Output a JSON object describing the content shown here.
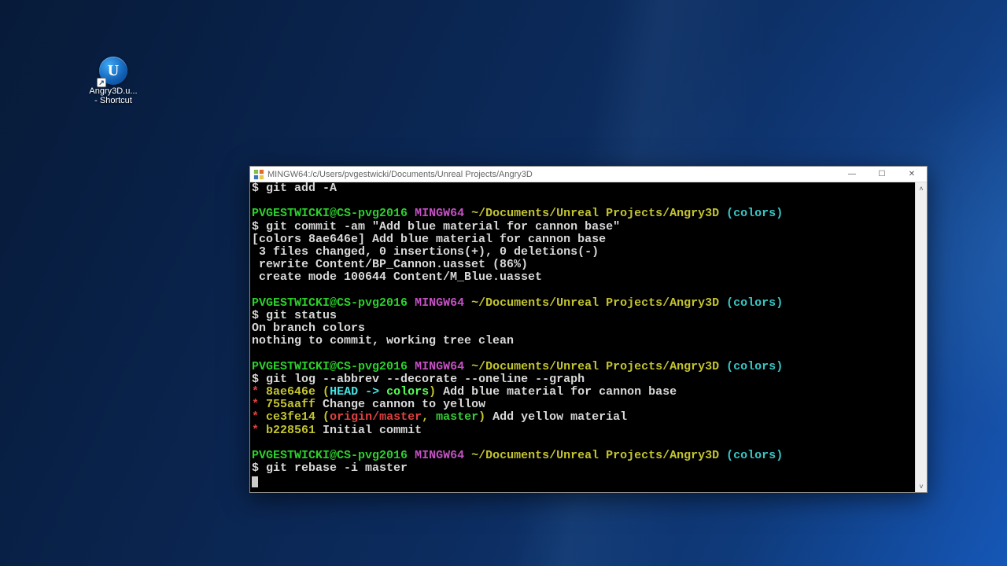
{
  "desktop_icon": {
    "glyph": "U",
    "label_line1": "Angry3D.u...",
    "label_line2": "- Shortcut",
    "shortcut_arrow": "↗"
  },
  "window": {
    "title": "MINGW64:/c/Users/pvgestwicki/Documents/Unreal Projects/Angry3D",
    "controls": {
      "minimize": "—",
      "maximize": "☐",
      "close": "✕"
    },
    "scrollbar": {
      "up": "˄",
      "down": "˅"
    }
  },
  "prompt": {
    "user_host": "PVGESTWICKI@CS-pvg2016",
    "shell": "MINGW64",
    "path": "~/Documents/Unreal Projects/Angry3D",
    "branch": "colors",
    "dollar": "$"
  },
  "terminal": {
    "cmd_add": "git add -A",
    "cmd_commit": "git commit -am \"Add blue material for cannon base\"",
    "commit_out_1": "[colors 8ae646e] Add blue material for cannon base",
    "commit_out_2": " 3 files changed, 0 insertions(+), 0 deletions(-)",
    "commit_out_3": " rewrite Content/BP_Cannon.uasset (86%)",
    "commit_out_4": " create mode 100644 Content/M_Blue.uasset",
    "cmd_status": "git status",
    "status_out_1": "On branch colors",
    "status_out_2": "nothing to commit, working tree clean",
    "cmd_log": "git log --abbrev --decorate --oneline --graph",
    "log": {
      "star": "*",
      "row1": {
        "hash": "8ae646e",
        "lp": " (",
        "head": "HEAD -> ",
        "branch": "colors",
        "rp": ")",
        "msg": " Add blue material for cannon base"
      },
      "row2": {
        "hash": "755aaff",
        "msg": " Change cannon to yellow"
      },
      "row3": {
        "hash": "ce3fe14",
        "lp": " (",
        "origin": "origin/master",
        "sep": ", ",
        "master": "master",
        "rp": ")",
        "msg": " Add yellow material"
      },
      "row4": {
        "hash": "b228561",
        "msg": " Initial commit"
      }
    },
    "cmd_rebase": "git rebase -i master"
  }
}
